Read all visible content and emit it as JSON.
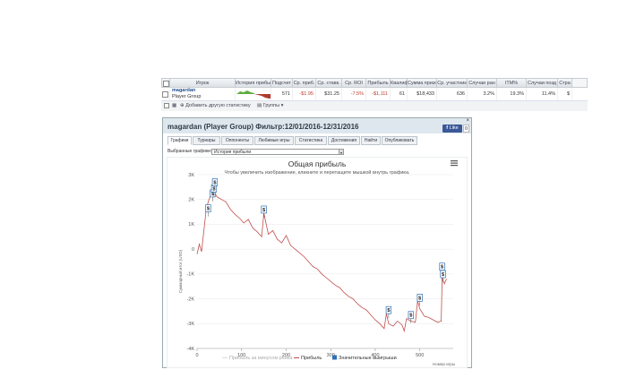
{
  "stats_table": {
    "headers": [
      "Игрок",
      "История прибы",
      "Подсчет",
      "Ср. приб.",
      "Ср. ставк.",
      "Ср. ROI",
      "Прибыль",
      "Квалиф",
      "Сумма призо",
      "Ср. участник",
      "Случаи ран",
      "ITM%",
      "Случаи позд",
      "Стра"
    ],
    "row": {
      "player_name": "magardan",
      "player_group": "Player Group",
      "count": "571",
      "avg_profit": "-$1.95",
      "avg_stake": "$31.25",
      "avg_roi": "-7.5%",
      "profit": "-$1,111",
      "qualified": "61",
      "prize_sum": "$18,433",
      "avg_entrants": "636",
      "early_cases": "3.2%",
      "itm": "19.3%",
      "late_cases": "11.4%",
      "last": "$"
    },
    "toolbar": {
      "add_stats": "Добавить другую статистику",
      "groups": "Группы"
    }
  },
  "popup": {
    "title": "magardan (Player Group) Фильтр:12/01/2016-12/31/2016",
    "like_label": "Like",
    "like_count": "0",
    "close": "×",
    "tabs": [
      "Графики",
      "Турниры",
      "Оппоненты",
      "Любимые игры",
      "Статистика",
      "Достижения",
      "Найти",
      "Опубликовать"
    ],
    "active_tab": 0,
    "selected_graphs_label": "Выбранные графики:",
    "selected_graph": "История прибыли"
  },
  "chart_data": {
    "type": "line",
    "title": "Общая прибыль",
    "subtitle": "Чтобы увеличить изображение, кликните и перетащите мышкой внутрь графика.",
    "xlabel": "Номер игры",
    "ylabel": "Суммарный итог (USD)",
    "xlim": [
      0,
      575
    ],
    "ylim": [
      -4000,
      3000
    ],
    "x_ticks": [
      "0",
      "100",
      "200",
      "300",
      "400",
      "500"
    ],
    "y_ticks": [
      "3K",
      "2K",
      "1K",
      "0",
      "-1K",
      "-2K",
      "-3K",
      "-4K"
    ],
    "legend": [
      "Прибыль за минусом рейка",
      "Прибыль",
      "Значительные выигрыши"
    ],
    "series": [
      {
        "name": "Прибыль",
        "color": "#c0504d",
        "x": [
          0,
          5,
          10,
          15,
          20,
          25,
          30,
          35,
          40,
          45,
          55,
          65,
          75,
          85,
          95,
          105,
          115,
          125,
          135,
          145,
          150,
          160,
          170,
          180,
          190,
          200,
          210,
          220,
          230,
          240,
          250,
          260,
          270,
          280,
          290,
          300,
          310,
          320,
          330,
          340,
          350,
          360,
          370,
          380,
          390,
          400,
          410,
          420,
          425,
          430,
          440,
          450,
          460,
          465,
          470,
          480,
          490,
          495,
          500,
          510,
          520,
          530,
          540,
          548,
          550,
          555,
          560
        ],
        "values": [
          -200,
          200,
          -100,
          700,
          1500,
          1900,
          2150,
          2200,
          2250,
          2100,
          2000,
          1900,
          1600,
          1400,
          1250,
          1050,
          1200,
          850,
          700,
          500,
          1450,
          600,
          750,
          400,
          250,
          550,
          150,
          0,
          -150,
          -300,
          -500,
          -700,
          -800,
          -1000,
          -1150,
          -1300,
          -1450,
          -1550,
          -1750,
          -1900,
          -2000,
          -2200,
          -2350,
          -2450,
          -2650,
          -2850,
          -3000,
          -3200,
          -2600,
          -3000,
          -3100,
          -2900,
          -3050,
          -3300,
          -2800,
          -2900,
          -2950,
          -2100,
          -2400,
          -2700,
          -2750,
          -2850,
          -2950,
          -2900,
          -1150,
          -1400,
          -1200
        ]
      }
    ],
    "markers": {
      "x": [
        25,
        35,
        38,
        40,
        150,
        430,
        480,
        500,
        550,
        552
      ],
      "values": [
        1500,
        2100,
        2300,
        2550,
        1450,
        -2600,
        -2800,
        -2100,
        -850,
        -1150
      ],
      "label": "$"
    }
  }
}
